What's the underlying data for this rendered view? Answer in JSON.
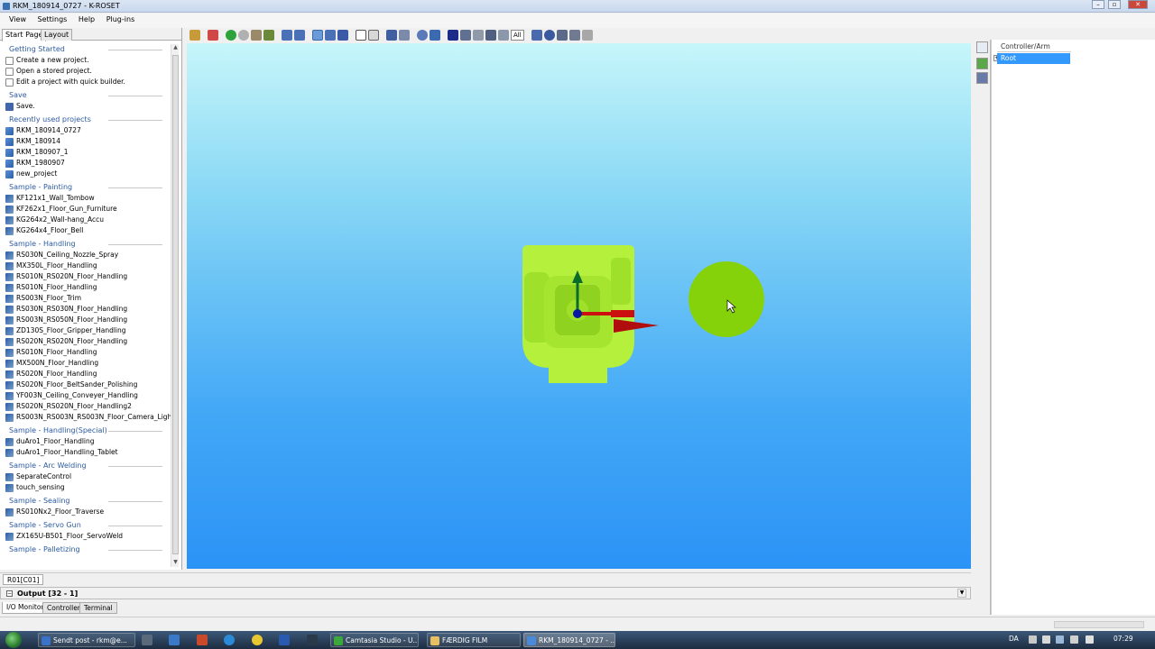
{
  "window": {
    "title": "RKM_180914_0727 - K-ROSET",
    "controls": [
      "–",
      "▫",
      "✕"
    ]
  },
  "menu": [
    "View",
    "Settings",
    "Help",
    "Plug-ins"
  ],
  "left_tabs": [
    "Start Page",
    "Layout"
  ],
  "sections": [
    {
      "title": "Getting Started",
      "icon": "doc",
      "items": [
        "Create a new project.",
        "Open a stored project.",
        "Edit a project with quick builder."
      ]
    },
    {
      "title": "Save",
      "icon": "save",
      "items": [
        "Save."
      ]
    },
    {
      "title": "Recently used projects",
      "icon": "proj",
      "items": [
        "RKM_180914_0727",
        "RKM_180914",
        "RKM_180907_1",
        "RKM_1980907",
        "new_project"
      ]
    },
    {
      "title": "Sample - Painting",
      "icon": "robot",
      "items": [
        "KF121x1_Wall_Tombow",
        "KF262x1_Floor_Gun_Furniture",
        "KG264x2_Wall-hang_Accu",
        "KG264x4_Floor_Bell"
      ]
    },
    {
      "title": "Sample - Handling",
      "icon": "robot",
      "items": [
        "RS030N_Ceiling_Nozzle_Spray",
        "MX350L_Floor_Handling",
        "RS010N_RS020N_Floor_Handling",
        "RS010N_Floor_Handling",
        "RS003N_Floor_Trim",
        "RS030N_RS030N_Floor_Handling",
        "RS003N_RS050N_Floor_Handling",
        "ZD130S_Floor_Gripper_Handling",
        "RS020N_RS020N_Floor_Handling",
        "RS010N_Floor_Handling",
        "MX500N_Floor_Handling",
        "RS020N_Floor_Handling",
        "RS020N_Floor_BeltSander_Polishing",
        "YF003N_Ceiling_Conveyer_Handling",
        "RS020N_RS020N_Floor_Handling2",
        "RS003N_RS003N_RS003N_Floor_Camera_Ligh..."
      ]
    },
    {
      "title": "Sample - Handling(Special)",
      "icon": "robot",
      "items": [
        "duAro1_Floor_Handling",
        "duAro1_Floor_Handling_Tablet"
      ]
    },
    {
      "title": "Sample - Arc Welding",
      "icon": "robot",
      "items": [
        "SeparateControl",
        "touch_sensing"
      ]
    },
    {
      "title": "Sample - Sealing",
      "icon": "robot",
      "items": [
        "RS010Nx2_Floor_Traverse"
      ]
    },
    {
      "title": "Sample - Servo Gun",
      "icon": "robot",
      "items": [
        "ZX165U-B501_Floor_ServoWeld"
      ]
    },
    {
      "title": "Sample - Palletizing",
      "icon": "robot",
      "items": []
    }
  ],
  "toolbar": {
    "all_label": "All"
  },
  "tree": {
    "header": "Controller/Arm",
    "root": "Root"
  },
  "robot_tab": "R01[C01]",
  "output": {
    "toggle": "−",
    "label": "Output [32 - 1]"
  },
  "bottom_tabs": [
    "I/O Monitor",
    "Controller",
    "Terminal"
  ],
  "taskbar": {
    "tasks": [
      "Sendt post - rkm@e...",
      "Camtasia Studio - U...",
      "FÆRDIG FILM",
      "RKM_180914_0727 - ..."
    ],
    "lang": "DA",
    "time": "07:29"
  },
  "colors": {
    "sky_top": "#c6f6fa",
    "sky_bottom": "#2b93f6",
    "robot_body": "#b4f03c",
    "robot_shade": "#8fd21f",
    "sphere": "#86d20a",
    "axis_x": "#cc1010",
    "axis_y": "#0b6b2b",
    "axis_z": "#0a1aa0",
    "selection": "#3399ff"
  }
}
